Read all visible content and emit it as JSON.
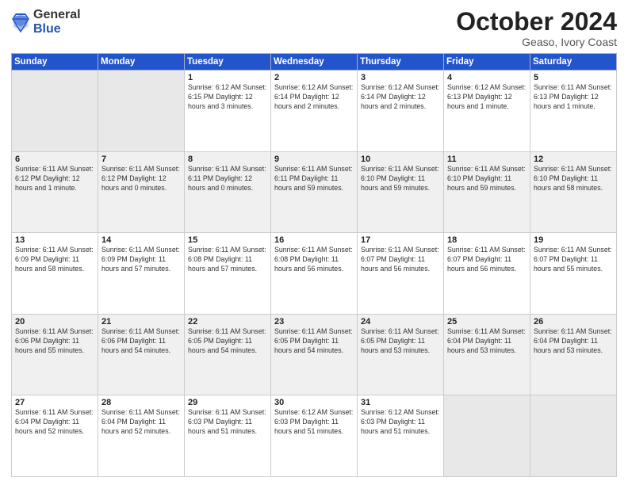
{
  "header": {
    "logo_general": "General",
    "logo_blue": "Blue",
    "month": "October 2024",
    "location": "Geaso, Ivory Coast"
  },
  "weekdays": [
    "Sunday",
    "Monday",
    "Tuesday",
    "Wednesday",
    "Thursday",
    "Friday",
    "Saturday"
  ],
  "weeks": [
    [
      {
        "day": "",
        "info": ""
      },
      {
        "day": "",
        "info": ""
      },
      {
        "day": "1",
        "info": "Sunrise: 6:12 AM\nSunset: 6:15 PM\nDaylight: 12 hours\nand 3 minutes."
      },
      {
        "day": "2",
        "info": "Sunrise: 6:12 AM\nSunset: 6:14 PM\nDaylight: 12 hours\nand 2 minutes."
      },
      {
        "day": "3",
        "info": "Sunrise: 6:12 AM\nSunset: 6:14 PM\nDaylight: 12 hours\nand 2 minutes."
      },
      {
        "day": "4",
        "info": "Sunrise: 6:12 AM\nSunset: 6:13 PM\nDaylight: 12 hours\nand 1 minute."
      },
      {
        "day": "5",
        "info": "Sunrise: 6:11 AM\nSunset: 6:13 PM\nDaylight: 12 hours\nand 1 minute."
      }
    ],
    [
      {
        "day": "6",
        "info": "Sunrise: 6:11 AM\nSunset: 6:12 PM\nDaylight: 12 hours\nand 1 minute."
      },
      {
        "day": "7",
        "info": "Sunrise: 6:11 AM\nSunset: 6:12 PM\nDaylight: 12 hours\nand 0 minutes."
      },
      {
        "day": "8",
        "info": "Sunrise: 6:11 AM\nSunset: 6:11 PM\nDaylight: 12 hours\nand 0 minutes."
      },
      {
        "day": "9",
        "info": "Sunrise: 6:11 AM\nSunset: 6:11 PM\nDaylight: 11 hours\nand 59 minutes."
      },
      {
        "day": "10",
        "info": "Sunrise: 6:11 AM\nSunset: 6:10 PM\nDaylight: 11 hours\nand 59 minutes."
      },
      {
        "day": "11",
        "info": "Sunrise: 6:11 AM\nSunset: 6:10 PM\nDaylight: 11 hours\nand 59 minutes."
      },
      {
        "day": "12",
        "info": "Sunrise: 6:11 AM\nSunset: 6:10 PM\nDaylight: 11 hours\nand 58 minutes."
      }
    ],
    [
      {
        "day": "13",
        "info": "Sunrise: 6:11 AM\nSunset: 6:09 PM\nDaylight: 11 hours\nand 58 minutes."
      },
      {
        "day": "14",
        "info": "Sunrise: 6:11 AM\nSunset: 6:09 PM\nDaylight: 11 hours\nand 57 minutes."
      },
      {
        "day": "15",
        "info": "Sunrise: 6:11 AM\nSunset: 6:08 PM\nDaylight: 11 hours\nand 57 minutes."
      },
      {
        "day": "16",
        "info": "Sunrise: 6:11 AM\nSunset: 6:08 PM\nDaylight: 11 hours\nand 56 minutes."
      },
      {
        "day": "17",
        "info": "Sunrise: 6:11 AM\nSunset: 6:07 PM\nDaylight: 11 hours\nand 56 minutes."
      },
      {
        "day": "18",
        "info": "Sunrise: 6:11 AM\nSunset: 6:07 PM\nDaylight: 11 hours\nand 56 minutes."
      },
      {
        "day": "19",
        "info": "Sunrise: 6:11 AM\nSunset: 6:07 PM\nDaylight: 11 hours\nand 55 minutes."
      }
    ],
    [
      {
        "day": "20",
        "info": "Sunrise: 6:11 AM\nSunset: 6:06 PM\nDaylight: 11 hours\nand 55 minutes."
      },
      {
        "day": "21",
        "info": "Sunrise: 6:11 AM\nSunset: 6:06 PM\nDaylight: 11 hours\nand 54 minutes."
      },
      {
        "day": "22",
        "info": "Sunrise: 6:11 AM\nSunset: 6:05 PM\nDaylight: 11 hours\nand 54 minutes."
      },
      {
        "day": "23",
        "info": "Sunrise: 6:11 AM\nSunset: 6:05 PM\nDaylight: 11 hours\nand 54 minutes."
      },
      {
        "day": "24",
        "info": "Sunrise: 6:11 AM\nSunset: 6:05 PM\nDaylight: 11 hours\nand 53 minutes."
      },
      {
        "day": "25",
        "info": "Sunrise: 6:11 AM\nSunset: 6:04 PM\nDaylight: 11 hours\nand 53 minutes."
      },
      {
        "day": "26",
        "info": "Sunrise: 6:11 AM\nSunset: 6:04 PM\nDaylight: 11 hours\nand 53 minutes."
      }
    ],
    [
      {
        "day": "27",
        "info": "Sunrise: 6:11 AM\nSunset: 6:04 PM\nDaylight: 11 hours\nand 52 minutes."
      },
      {
        "day": "28",
        "info": "Sunrise: 6:11 AM\nSunset: 6:04 PM\nDaylight: 11 hours\nand 52 minutes."
      },
      {
        "day": "29",
        "info": "Sunrise: 6:11 AM\nSunset: 6:03 PM\nDaylight: 11 hours\nand 51 minutes."
      },
      {
        "day": "30",
        "info": "Sunrise: 6:12 AM\nSunset: 6:03 PM\nDaylight: 11 hours\nand 51 minutes."
      },
      {
        "day": "31",
        "info": "Sunrise: 6:12 AM\nSunset: 6:03 PM\nDaylight: 11 hours\nand 51 minutes."
      },
      {
        "day": "",
        "info": ""
      },
      {
        "day": "",
        "info": ""
      }
    ]
  ]
}
